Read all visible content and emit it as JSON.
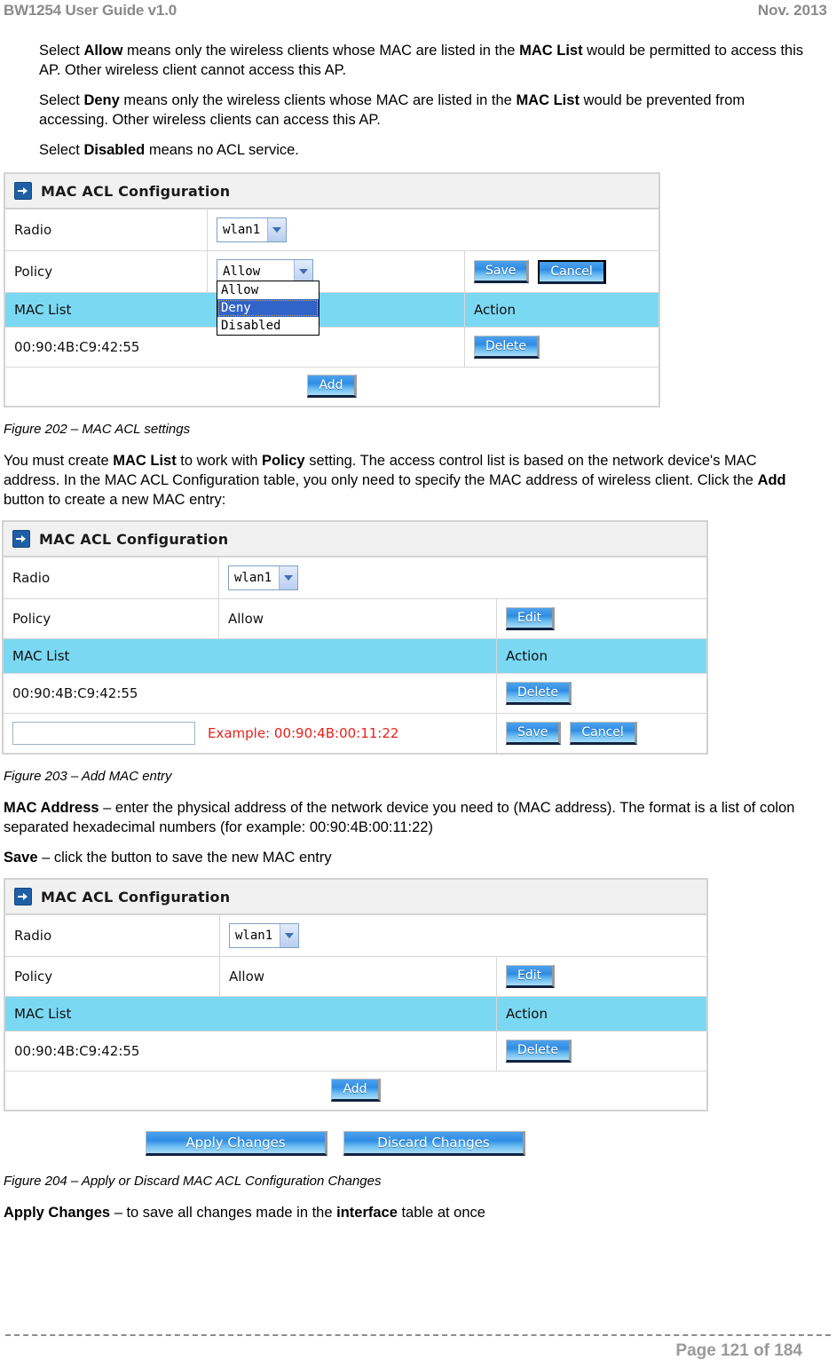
{
  "runhead": {
    "left": "BW1254 User Guide v1.0",
    "right": "Nov. 2013"
  },
  "paragraphs": {
    "allow": {
      "p1": "Select ",
      "b1": "Allow",
      "p2": " means only the wireless clients whose MAC are listed in the ",
      "b2": "MAC List",
      "p3": " would be permitted to access this AP. Other wireless client cannot access this AP."
    },
    "deny": {
      "p1": "Select ",
      "b1": "Deny",
      "p2": " means only the wireless clients whose MAC are listed in the ",
      "b2": "MAC List",
      "p3": " would be prevented from accessing. Other wireless clients can access this AP."
    },
    "disabled": {
      "p1": "Select ",
      "b1": "Disabled",
      "p2": " means no ACL service."
    },
    "maclist_intro": {
      "p1": "You must create ",
      "b1": "MAC List",
      "p2": " to work with ",
      "b2": "Policy",
      "p3": " setting. The access control list is based on the network device's MAC address. In the MAC ACL Configuration table, you only need to specify the MAC address of wireless client. Click the ",
      "b3": "Add",
      "p4": " button to create a new MAC entry:"
    },
    "mac_address": {
      "b1": "MAC Address",
      "p1": " – enter the physical address of the network device you need to (MAC address). The format is a list of colon separated hexadecimal numbers (for example: 00:90:4B:00:11:22)"
    },
    "save_desc": {
      "b1": "Save",
      "p1": " – click the button to save the new MAC entry"
    },
    "apply_desc": {
      "b1": "Apply Changes",
      "p1": " – to save all changes made in the ",
      "b2": "interface",
      "p2": " table at once"
    }
  },
  "captions": {
    "fig202": "Figure 202 – MAC ACL settings",
    "fig203": "Figure 203 – Add MAC entry",
    "fig204": "Figure 204 – Apply or Discard MAC ACL Configuration Changes"
  },
  "figure202": {
    "panel_title": "MAC ACL Configuration",
    "rows": {
      "radio_label": "Radio",
      "radio_value": "wlan1",
      "policy_label": "Policy",
      "policy_value": "Allow",
      "policy_options": [
        "Allow",
        "Deny",
        "Disabled"
      ],
      "policy_highlighted": "Deny",
      "save_label": "Save",
      "cancel_label": "Cancel",
      "maclist_header": "MAC List",
      "action_header": "Action",
      "mac_entry": "00:90:4B:C9:42:55",
      "delete_label": "Delete",
      "add_label": "Add"
    }
  },
  "figure203": {
    "panel_title": "MAC ACL Configuration",
    "rows": {
      "radio_label": "Radio",
      "radio_value": "wlan1",
      "policy_label": "Policy",
      "policy_value": "Allow",
      "edit_label": "Edit",
      "maclist_header": "MAC List",
      "action_header": "Action",
      "mac_entry": "00:90:4B:C9:42:55",
      "delete_label": "Delete",
      "mac_input_value": "",
      "mac_input_placeholder": "",
      "example_text": "Example: 00:90:4B:00:11:22",
      "save_label": "Save",
      "cancel_label": "Cancel"
    }
  },
  "figure204": {
    "panel_title": "MAC ACL Configuration",
    "rows": {
      "radio_label": "Radio",
      "radio_value": "wlan1",
      "policy_label": "Policy",
      "policy_value": "Allow",
      "edit_label": "Edit",
      "maclist_header": "MAC List",
      "action_header": "Action",
      "mac_entry": "00:90:4B:C9:42:55",
      "delete_label": "Delete",
      "add_label": "Add"
    },
    "apply_label": "Apply Changes",
    "discard_label": "Discard Changes"
  },
  "footer": {
    "page": "Page 121 of 184"
  },
  "colors": {
    "cyan_header": "#7bd8f2",
    "panel_title_bg": "#f1f1f1",
    "button_blue": "#2f8ce4",
    "example_red": "#e8201b",
    "runhead_gray": "#8a8a8a"
  }
}
